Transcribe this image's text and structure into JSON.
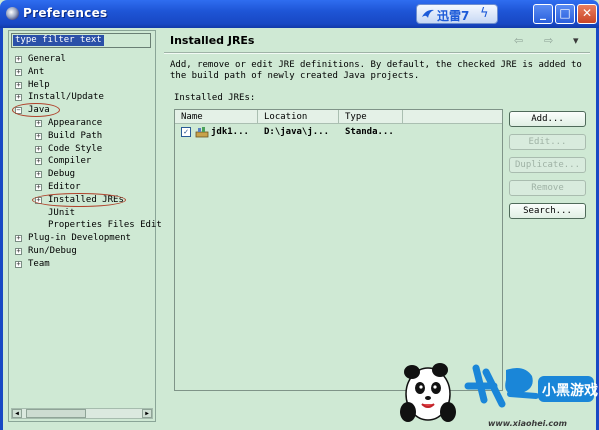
{
  "window": {
    "title": "Preferences",
    "badge_text": "迅雷7",
    "buttons": {
      "minimize": "_",
      "maximize": "□",
      "close": "✕"
    }
  },
  "filter": {
    "placeholder": "type filter text"
  },
  "tree": {
    "items": [
      {
        "label": "General",
        "level": 0,
        "expander": "+"
      },
      {
        "label": "Ant",
        "level": 0,
        "expander": "+"
      },
      {
        "label": "Help",
        "level": 0,
        "expander": "+"
      },
      {
        "label": "Install/Update",
        "level": 0,
        "expander": "+"
      },
      {
        "label": "Java",
        "level": 0,
        "expander": "−",
        "highlighted": true
      },
      {
        "label": "Appearance",
        "level": 1,
        "expander": "+"
      },
      {
        "label": "Build Path",
        "level": 1,
        "expander": "+"
      },
      {
        "label": "Code Style",
        "level": 1,
        "expander": "+"
      },
      {
        "label": "Compiler",
        "level": 1,
        "expander": "+"
      },
      {
        "label": "Debug",
        "level": 1,
        "expander": "+"
      },
      {
        "label": "Editor",
        "level": 1,
        "expander": "+"
      },
      {
        "label": "Installed JREs",
        "level": 1,
        "expander": "+",
        "highlighted": true,
        "selected": true
      },
      {
        "label": "JUnit",
        "level": 1,
        "expander": ""
      },
      {
        "label": "Properties Files Edit",
        "level": 1,
        "expander": ""
      },
      {
        "label": "Plug-in Development",
        "level": 0,
        "expander": "+"
      },
      {
        "label": "Run/Debug",
        "level": 0,
        "expander": "+"
      },
      {
        "label": "Team",
        "level": 0,
        "expander": "+"
      }
    ]
  },
  "page": {
    "title": "Installed JREs",
    "description": "Add, remove or edit JRE definitions. By default, the checked JRE is added to the build path of newly created Java projects.",
    "subheading": "Installed JREs:",
    "nav": {
      "back": "⇦",
      "forward": "⇨",
      "menu": "▾"
    }
  },
  "jre_table": {
    "columns": [
      "Name",
      "Location",
      "Type"
    ],
    "rows": [
      {
        "checked": true,
        "name": "jdk1...",
        "location": "D:\\java\\j...",
        "type": "Standa..."
      }
    ]
  },
  "buttons": {
    "add": "Add...",
    "edit": "Edit...",
    "duplicate": "Duplicate...",
    "remove": "Remove",
    "search": "Search..."
  },
  "watermark": {
    "url": "www.xiaohei.com",
    "brand": "小黑游戏"
  },
  "colors": {
    "background": "#cfe9d4",
    "titlebar": "#1e55d6",
    "highlight_ring": "#b0432c",
    "selection": "#2b50a8"
  }
}
